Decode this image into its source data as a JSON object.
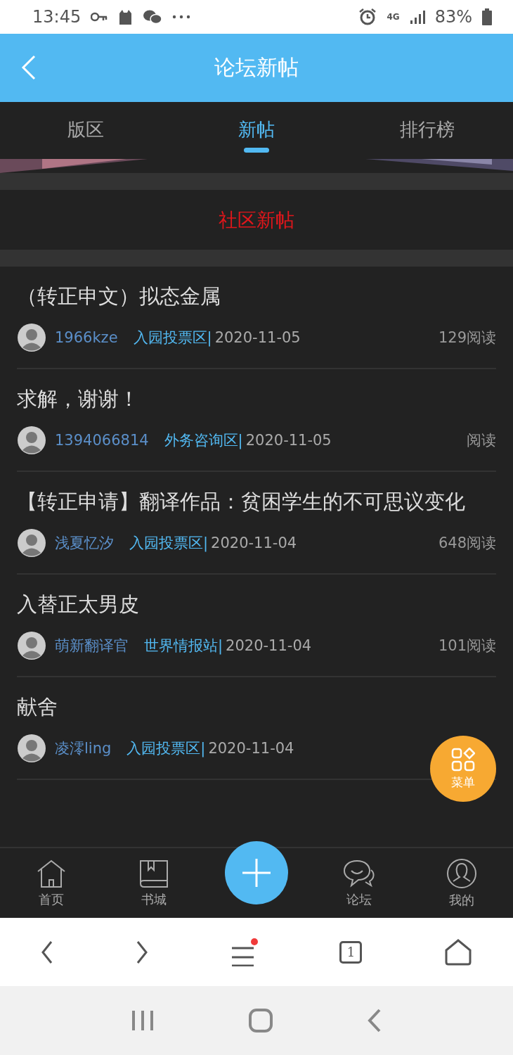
{
  "status_bar": {
    "time": "13:45",
    "battery": "83%",
    "network": "4G"
  },
  "header": {
    "title": "论坛新帖"
  },
  "tabs": [
    {
      "label": "版区",
      "selected": false
    },
    {
      "label": "新帖",
      "selected": true
    },
    {
      "label": "排行榜",
      "selected": false
    }
  ],
  "section_title": "社区新帖",
  "posts": [
    {
      "title": "（转正申文）拟态金属",
      "author": "1966kze",
      "board": "入园投票区|",
      "date": "2020-11-05",
      "views": "129阅读"
    },
    {
      "title": "求解，谢谢！",
      "author": "1394066814",
      "board": "外务咨询区|",
      "date": "2020-11-05",
      "views": "阅读"
    },
    {
      "title": "【转正申请】翻译作品：贫困学生的不可思议变化",
      "author": "浅夏忆汐",
      "board": "入园投票区|",
      "date": "2020-11-04",
      "views": "648阅读"
    },
    {
      "title": "入替正太男皮",
      "author": "萌新翻译官",
      "board": "世界情报站|",
      "date": "2020-11-04",
      "views": "101阅读"
    },
    {
      "title": "献舍",
      "author": "凌澪ling",
      "board": "入园投票区|",
      "date": "2020-11-04"
    }
  ],
  "menu_button": {
    "label": "菜单"
  },
  "bottom_nav": [
    {
      "label": "首页",
      "kind": "home"
    },
    {
      "label": "书城",
      "kind": "book"
    },
    {
      "kind": "add"
    },
    {
      "label": "论坛",
      "kind": "chat"
    },
    {
      "label": "我的",
      "kind": "profile"
    }
  ],
  "browser_bar": {
    "tab_count": "1",
    "menu_badge": true
  }
}
